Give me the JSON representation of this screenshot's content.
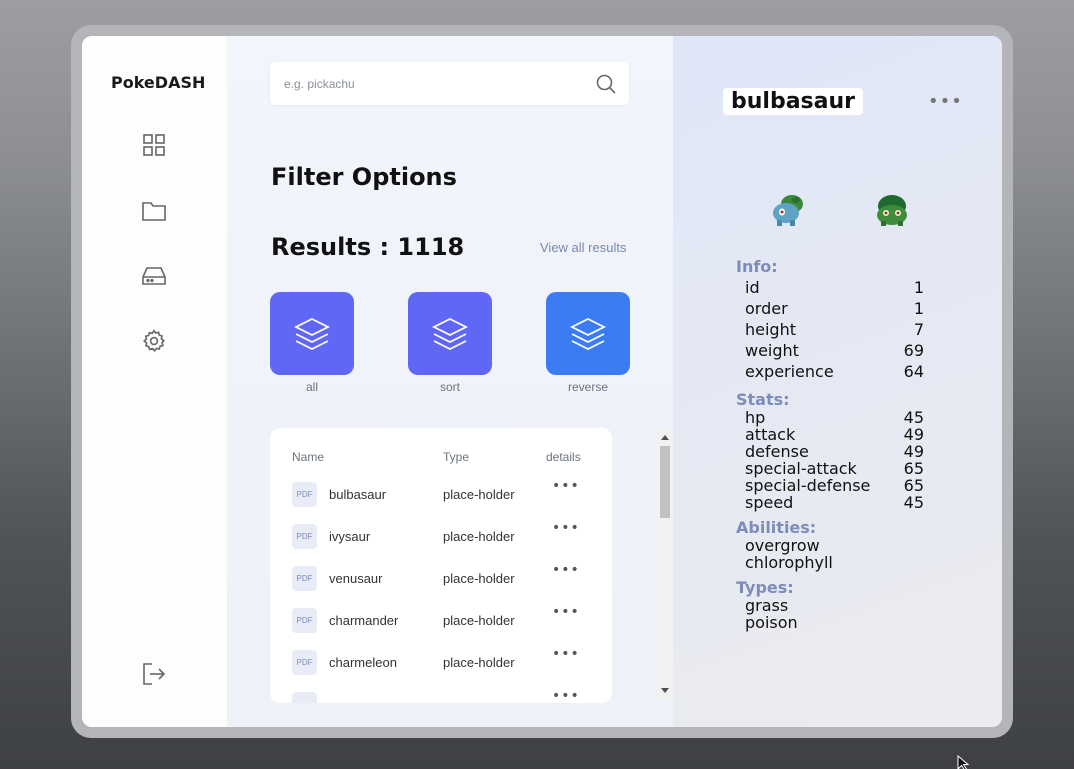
{
  "app": {
    "brand": "PokeDASH"
  },
  "search": {
    "placeholder": "e.g. pickachu"
  },
  "filter": {
    "title": "Filter Options"
  },
  "results": {
    "label": "Results : 1118",
    "view_all": "View all results"
  },
  "tiles": [
    {
      "label": "all",
      "color": "#6167f5"
    },
    {
      "label": "sort",
      "color": "#6167f5"
    },
    {
      "label": "reverse",
      "color": "#3b7bf3"
    }
  ],
  "table": {
    "headers": {
      "name": "Name",
      "type": "Type",
      "details": "details"
    },
    "file_badge": "PDF",
    "rows": [
      {
        "name": "bulbasaur",
        "type": "place-holder"
      },
      {
        "name": "ivysaur",
        "type": "place-holder"
      },
      {
        "name": "venusaur",
        "type": "place-holder"
      },
      {
        "name": "charmander",
        "type": "place-holder"
      },
      {
        "name": "charmeleon",
        "type": "place-holder"
      }
    ]
  },
  "detail": {
    "name": "bulbasaur",
    "info_title": "Info:",
    "info": [
      {
        "k": "id",
        "v": "1"
      },
      {
        "k": "order",
        "v": "1"
      },
      {
        "k": "height",
        "v": "7"
      },
      {
        "k": "weight",
        "v": "69"
      },
      {
        "k": "experience",
        "v": "64"
      }
    ],
    "stats_title": "Stats:",
    "stats": [
      {
        "k": "hp",
        "v": "45"
      },
      {
        "k": "attack",
        "v": "49"
      },
      {
        "k": "defense",
        "v": "49"
      },
      {
        "k": "special-attack",
        "v": "65"
      },
      {
        "k": "special-defense",
        "v": "65"
      },
      {
        "k": "speed",
        "v": "45"
      }
    ],
    "abilities_title": "Abilities:",
    "abilities": [
      "overgrow",
      "chlorophyll"
    ],
    "types_title": "Types:",
    "types": [
      "grass",
      "poison"
    ]
  },
  "colors": {
    "accent": "#6167f5",
    "accent_alt": "#3b7bf3",
    "section_heading": "#7b8db8"
  }
}
